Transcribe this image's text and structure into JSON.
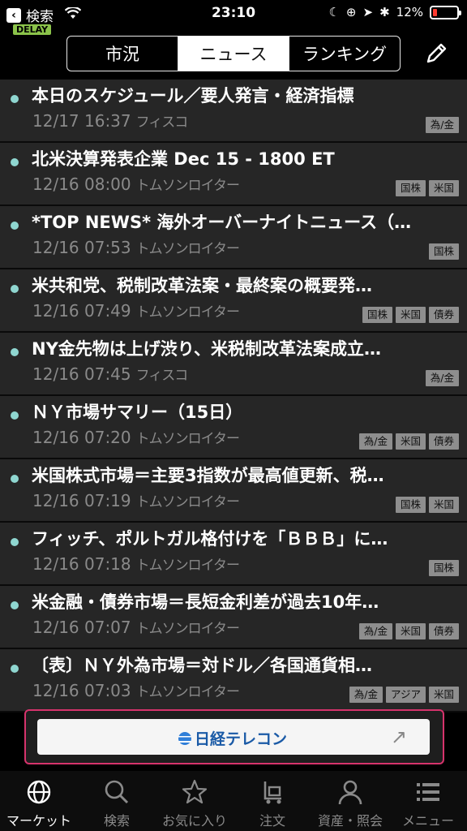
{
  "status_bar": {
    "back_label": "検索",
    "time": "23:10",
    "battery": "12%",
    "delay_badge": "DELAY"
  },
  "header": {
    "segments": [
      "市況",
      "ニュース",
      "ランキング"
    ],
    "active_segment": 1
  },
  "news": [
    {
      "headline": "本日のスケジュール／要人発言・経済指標",
      "datetime": "12/17 16:37",
      "source": "フィスコ",
      "tags": [
        "為/金"
      ]
    },
    {
      "headline": "北米決算発表企業 Dec 15 - 1800 ET",
      "datetime": "12/16 08:00",
      "source": "トムソンロイター",
      "tags": [
        "国株",
        "米国"
      ]
    },
    {
      "headline": "*TOP NEWS* 海外オーバーナイトニュース（…",
      "datetime": "12/16 07:53",
      "source": "トムソンロイター",
      "tags": [
        "国株"
      ]
    },
    {
      "headline": "米共和党、税制改革法案・最終案の概要発…",
      "datetime": "12/16 07:49",
      "source": "トムソンロイター",
      "tags": [
        "国株",
        "米国",
        "債券"
      ]
    },
    {
      "headline": "NY金先物は上げ渋り、米税制改革法案成立…",
      "datetime": "12/16 07:45",
      "source": "フィスコ",
      "tags": [
        "為/金"
      ]
    },
    {
      "headline": "ＮＹ市場サマリー（15日）",
      "datetime": "12/16 07:20",
      "source": "トムソンロイター",
      "tags": [
        "為/金",
        "米国",
        "債券"
      ]
    },
    {
      "headline": "米国株式市場＝主要3指数が最高値更新、税…",
      "datetime": "12/16 07:19",
      "source": "トムソンロイター",
      "tags": [
        "国株",
        "米国"
      ]
    },
    {
      "headline": "フィッチ、ポルトガル格付けを「ＢＢＢ」に…",
      "datetime": "12/16 07:18",
      "source": "トムソンロイター",
      "tags": [
        "国株"
      ]
    },
    {
      "headline": "米金融・債券市場＝長短金利差が過去10年…",
      "datetime": "12/16 07:07",
      "source": "トムソンロイター",
      "tags": [
        "為/金",
        "米国",
        "債券"
      ]
    },
    {
      "headline": "〔表〕ＮＹ外為市場＝対ドル／各国通貨相…",
      "datetime": "12/16 07:03",
      "source": "トムソンロイター",
      "tags": [
        "為/金",
        "アジア",
        "米国"
      ]
    }
  ],
  "banner": {
    "label": "日経テレコン",
    "arrow": "↗"
  },
  "tabs": [
    {
      "label": "マーケット",
      "icon": "globe-icon"
    },
    {
      "label": "検索",
      "icon": "search-icon"
    },
    {
      "label": "お気に入り",
      "icon": "star-icon"
    },
    {
      "label": "注文",
      "icon": "cart-icon"
    },
    {
      "label": "資産・照会",
      "icon": "person-icon"
    },
    {
      "label": "メニュー",
      "icon": "menu-icon"
    }
  ],
  "active_tab": 0,
  "colors": {
    "accent_dot": "#8fd6d0",
    "banner_border": "#d6336c",
    "delay_badge": "#8bc34a"
  }
}
